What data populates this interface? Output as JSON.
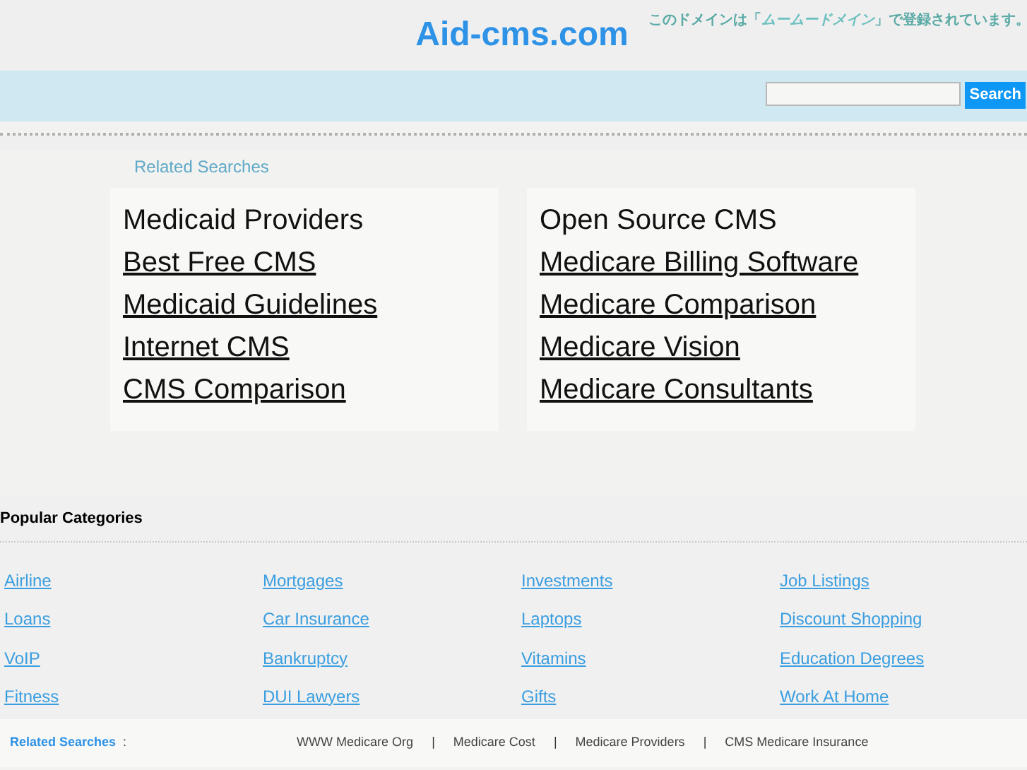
{
  "header": {
    "title": "Aid-cms.com",
    "registrar_notice": {
      "before": "このドメインは「",
      "brand": "ムームードメイン",
      "after": "」で登録されています。"
    }
  },
  "search": {
    "button": "Search"
  },
  "related_searches": {
    "label": "Related Searches",
    "columns": [
      [
        {
          "label": "Medicaid Providers",
          "underlined": false
        },
        {
          "label": "Best Free CMS",
          "underlined": true
        },
        {
          "label": "Medicaid Guidelines",
          "underlined": true
        },
        {
          "label": "Internet CMS",
          "underlined": true
        },
        {
          "label": "CMS Comparison",
          "underlined": true
        }
      ],
      [
        {
          "label": "Open Source CMS",
          "underlined": false
        },
        {
          "label": "Medicare Billing Software",
          "underlined": true
        },
        {
          "label": "Medicare Comparison",
          "underlined": true
        },
        {
          "label": "Medicare Vision",
          "underlined": true
        },
        {
          "label": "Medicare Consultants",
          "underlined": true
        }
      ]
    ]
  },
  "popular_categories": {
    "title": "Popular Categories",
    "columns": [
      [
        "Airline",
        "Loans",
        "VoIP",
        "Fitness"
      ],
      [
        "Mortgages",
        "Car Insurance",
        "Bankruptcy",
        "DUI Lawyers"
      ],
      [
        "Investments",
        "Laptops",
        "Vitamins",
        "Gifts"
      ],
      [
        "Job Listings",
        "Discount Shopping",
        "Education Degrees",
        "Work At Home"
      ]
    ]
  },
  "footer": {
    "label": "Related Searches",
    "colon": ":",
    "separator": "|",
    "links": [
      "WWW Medicare Org",
      "Medicare Cost",
      "Medicare Providers",
      "CMS Medicare Insurance"
    ]
  }
}
